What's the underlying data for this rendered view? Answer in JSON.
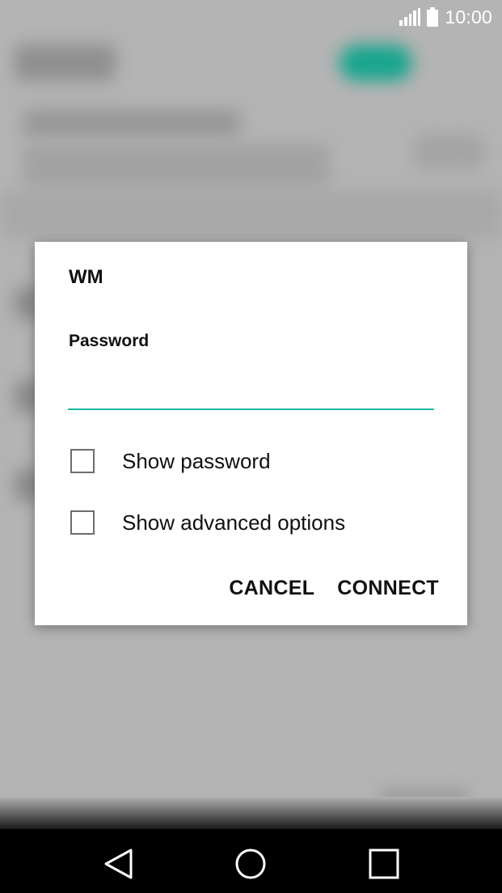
{
  "status_bar": {
    "time": "10:00",
    "icons": [
      "signal-icon",
      "battery-icon"
    ]
  },
  "dialog": {
    "title": "WM",
    "password_label": "Password",
    "password_value": "",
    "options": [
      {
        "label": "Show password",
        "checked": false
      },
      {
        "label": "Show advanced options",
        "checked": false
      }
    ],
    "cancel_label": "CANCEL",
    "connect_label": "CONNECT",
    "accent_color": "#1fb8a1"
  },
  "nav_bar": {
    "buttons": [
      "back-icon",
      "home-icon",
      "recents-icon"
    ]
  }
}
